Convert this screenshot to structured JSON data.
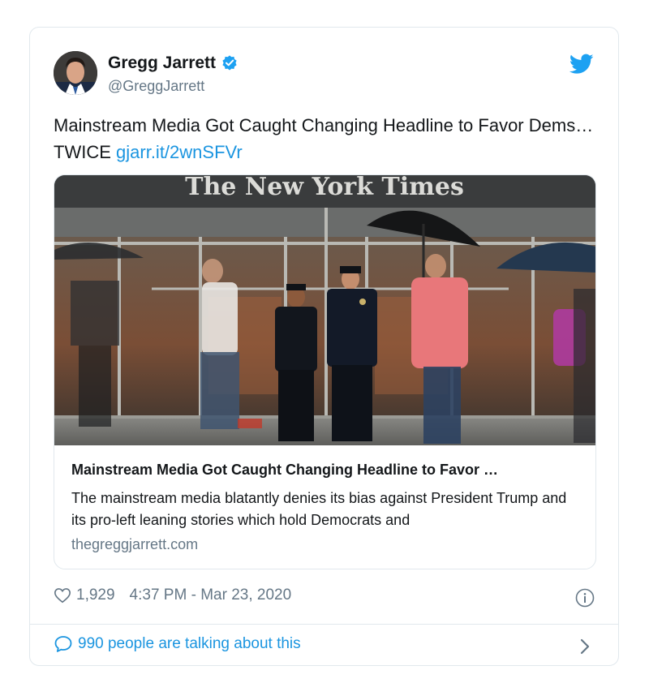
{
  "author": {
    "name": "Gregg Jarrett",
    "handle": "@GreggJarrett",
    "verified": true
  },
  "tweet": {
    "text": "Mainstream Media Got Caught Changing Headline to Favor Dems…TWICE",
    "link": "gjarr.it/2wnSFVr"
  },
  "card": {
    "image_sign": "The New York Times",
    "title": "Mainstream Media Got Caught Changing Headline to Favor …",
    "description": "The mainstream media blatantly denies its bias against President Trump and its pro-left leaning stories which hold Democrats and",
    "domain": "thegreggjarrett.com"
  },
  "meta": {
    "likes": "1,929",
    "timestamp": "4:37 PM - Mar 23, 2020"
  },
  "footer": {
    "talking": "990 people are talking about this"
  },
  "icons": {
    "verified": "verified-badge-icon",
    "brand": "twitter-bird-icon",
    "like": "heart-icon",
    "info": "info-icon",
    "conversation": "speech-bubble-icon",
    "open": "chevron-right-icon"
  },
  "colors": {
    "link": "#1b95e0",
    "muted": "#657786",
    "border": "#e1e8ed",
    "pink_shirt": "#e8777a"
  }
}
